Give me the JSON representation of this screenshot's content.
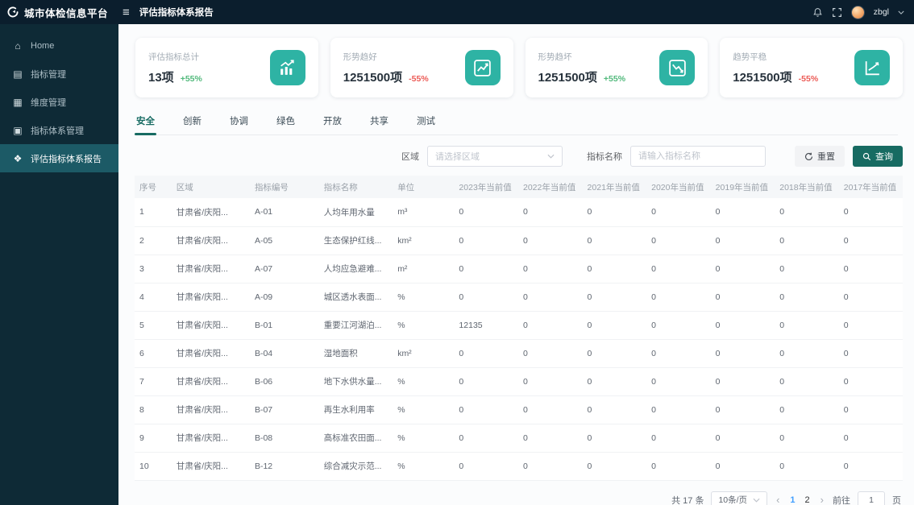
{
  "brand": {
    "title": "城市体检信息平台"
  },
  "topbar": {
    "page_title": "评估指标体系报告",
    "username": "zbgl"
  },
  "sidebar": {
    "items": [
      {
        "label": "Home",
        "icon": "home-icon",
        "active": false
      },
      {
        "label": "指标管理",
        "icon": "indicator-manage-icon",
        "active": false
      },
      {
        "label": "维度管理",
        "icon": "dimension-manage-icon",
        "active": false
      },
      {
        "label": "指标体系管理",
        "icon": "indicator-system-manage-icon",
        "active": false
      },
      {
        "label": "评估指标体系报告",
        "icon": "report-grid-icon",
        "active": true
      }
    ]
  },
  "cards": [
    {
      "label": "评估指标总计",
      "value": "13项",
      "delta": "+55%",
      "icon": "bar-chart-up-icon"
    },
    {
      "label": "形势趋好",
      "value": "1251500项",
      "delta": "-55%",
      "icon": "line-chart-up-icon"
    },
    {
      "label": "形势趋坏",
      "value": "1251500项",
      "delta": "+55%",
      "icon": "line-chart-down-icon"
    },
    {
      "label": "趋势平稳",
      "value": "1251500项",
      "delta": "-55%",
      "icon": "line-chart-flat-icon"
    }
  ],
  "tabs": [
    {
      "label": "安全",
      "active": true
    },
    {
      "label": "创新",
      "active": false
    },
    {
      "label": "协调",
      "active": false
    },
    {
      "label": "绿色",
      "active": false
    },
    {
      "label": "开放",
      "active": false
    },
    {
      "label": "共享",
      "active": false
    },
    {
      "label": "测试",
      "active": false
    }
  ],
  "filters": {
    "region_label": "区域",
    "region_placeholder": "请选择区域",
    "name_label": "指标名称",
    "name_placeholder": "请输入指标名称",
    "reset_label": "重置",
    "search_label": "查询"
  },
  "table": {
    "headers": [
      "序号",
      "区域",
      "指标编号",
      "指标名称",
      "单位",
      "2023年当前值",
      "2022年当前值",
      "2021年当前值",
      "2020年当前值",
      "2019年当前值",
      "2018年当前值",
      "2017年当前值"
    ],
    "rows": [
      {
        "seq": "1",
        "region": "甘肃省/庆阳...",
        "code": "A-01",
        "name": "人均年用水量",
        "unit": "m³",
        "values": [
          "0",
          "0",
          "0",
          "0",
          "0",
          "0",
          "0"
        ]
      },
      {
        "seq": "2",
        "region": "甘肃省/庆阳...",
        "code": "A-05",
        "name": "生态保护红线...",
        "unit": "km²",
        "values": [
          "0",
          "0",
          "0",
          "0",
          "0",
          "0",
          "0"
        ]
      },
      {
        "seq": "3",
        "region": "甘肃省/庆阳...",
        "code": "A-07",
        "name": "人均应急避难...",
        "unit": "m²",
        "values": [
          "0",
          "0",
          "0",
          "0",
          "0",
          "0",
          "0"
        ]
      },
      {
        "seq": "4",
        "region": "甘肃省/庆阳...",
        "code": "A-09",
        "name": "城区透水表面...",
        "unit": "%",
        "values": [
          "0",
          "0",
          "0",
          "0",
          "0",
          "0",
          "0"
        ]
      },
      {
        "seq": "5",
        "region": "甘肃省/庆阳...",
        "code": "B-01",
        "name": "重要江河湖泊...",
        "unit": "%",
        "values": [
          "12135",
          "0",
          "0",
          "0",
          "0",
          "0",
          "0"
        ]
      },
      {
        "seq": "6",
        "region": "甘肃省/庆阳...",
        "code": "B-04",
        "name": "湿地面积",
        "unit": "km²",
        "values": [
          "0",
          "0",
          "0",
          "0",
          "0",
          "0",
          "0"
        ]
      },
      {
        "seq": "7",
        "region": "甘肃省/庆阳...",
        "code": "B-06",
        "name": "地下水供水量...",
        "unit": "%",
        "values": [
          "0",
          "0",
          "0",
          "0",
          "0",
          "0",
          "0"
        ]
      },
      {
        "seq": "8",
        "region": "甘肃省/庆阳...",
        "code": "B-07",
        "name": "再生水利用率",
        "unit": "%",
        "values": [
          "0",
          "0",
          "0",
          "0",
          "0",
          "0",
          "0"
        ]
      },
      {
        "seq": "9",
        "region": "甘肃省/庆阳...",
        "code": "B-08",
        "name": "高标准农田面...",
        "unit": "%",
        "values": [
          "0",
          "0",
          "0",
          "0",
          "0",
          "0",
          "0"
        ]
      },
      {
        "seq": "10",
        "region": "甘肃省/庆阳...",
        "code": "B-12",
        "name": "综合减灾示范...",
        "unit": "%",
        "values": [
          "0",
          "0",
          "0",
          "0",
          "0",
          "0",
          "0"
        ]
      }
    ]
  },
  "pagination": {
    "total_label": "共 17 条",
    "page_size": "10条/页",
    "prev": "‹",
    "next": "›",
    "pages": [
      {
        "label": "1",
        "active": true
      },
      {
        "label": "2",
        "active": false
      }
    ],
    "jump_label": "前往",
    "jump_value": "1",
    "page_suffix": "页"
  },
  "colors": {
    "topbar-bg": "#0b1e2d",
    "sidebar-bg": "#0e2a36",
    "sidebar-active-bg": "#1c5a66",
    "accent": "#2eb3a4",
    "primary": "#176b62",
    "green": "#52b97c",
    "red": "#ec5b56",
    "page-active": "#409eff"
  }
}
